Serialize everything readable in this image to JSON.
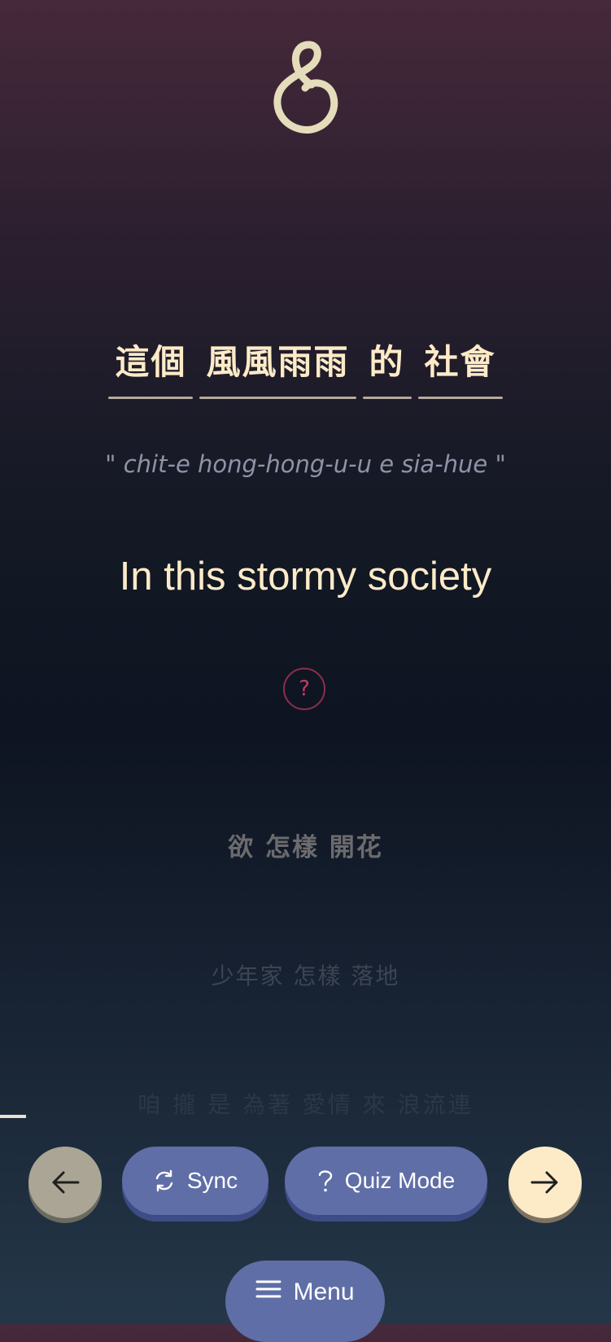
{
  "logo": {
    "icon": "swirl-logo-icon",
    "color": "#e4dcba"
  },
  "lyrics": {
    "current": {
      "words": [
        "這個",
        "風風雨雨",
        "的",
        "社會"
      ],
      "romanization": "\"  chit-e hong-hong-u-u e sia-hue  \"",
      "translation": "In this stormy society"
    },
    "upcoming": [
      "欲 怎樣 開花",
      "少年家 怎樣 落地",
      "咱 攏 是 為著 愛情 來 浪流連"
    ]
  },
  "help": {
    "label": "?",
    "icon": "question-icon"
  },
  "controls": {
    "prev": {
      "icon": "arrow-left-icon"
    },
    "sync": {
      "label": "Sync",
      "icon": "refresh-icon"
    },
    "quiz": {
      "label": "Quiz Mode",
      "icon": "question-icon"
    },
    "next": {
      "icon": "arrow-right-icon"
    }
  },
  "menu": {
    "label": "Menu",
    "icon": "hamburger-icon"
  },
  "colors": {
    "accent": "#5f6ea6",
    "text": "#fdebc8",
    "help": "#c43b66"
  }
}
